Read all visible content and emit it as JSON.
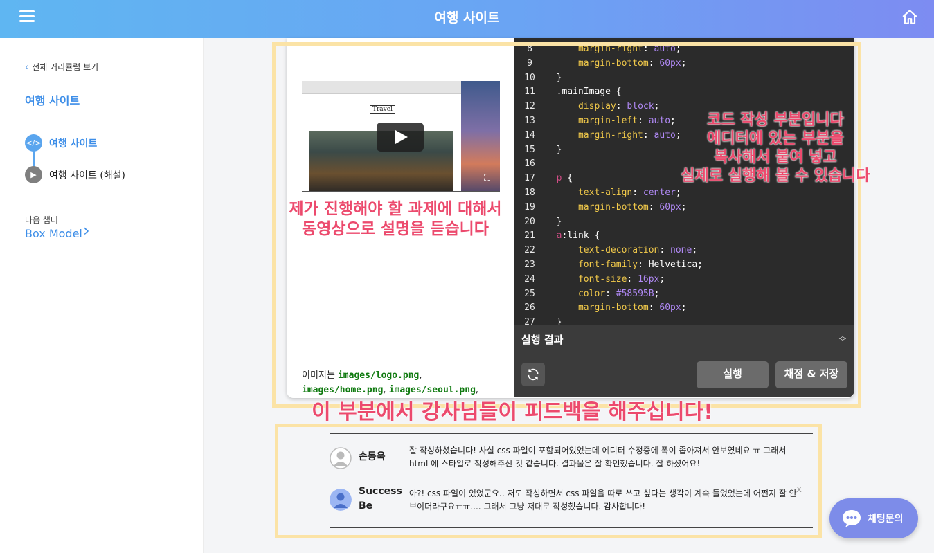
{
  "header": {
    "title": "여행 사이트",
    "menu_icon": "hamburger-icon",
    "home_icon": "home-icon"
  },
  "sidebar": {
    "back_label": "전체 커리큘럼 보기",
    "course_title": "여행 사이트",
    "lessons": [
      {
        "label": "여행 사이트",
        "icon": "code-icon",
        "active": true
      },
      {
        "label": "여행 사이트 (해설)",
        "icon": "play-icon",
        "active": false
      }
    ],
    "next_chapter": {
      "caption": "다음 챕터",
      "title": "Box Model"
    }
  },
  "video": {
    "logo_text": "Travel"
  },
  "description": {
    "prefix": "이미지는 ",
    "files": [
      "images/logo.png",
      "images/home.png",
      "images/seoul.png"
    ],
    "sep": ","
  },
  "editor": {
    "lines": [
      {
        "n": "8",
        "indent": "    ",
        "prop": "margin-right",
        "val": "auto"
      },
      {
        "n": "9",
        "indent": "    ",
        "prop": "margin-bottom",
        "val": "60px"
      },
      {
        "n": "10",
        "brace": "}"
      },
      {
        "n": "11",
        "selector": ".mainImage",
        "open": " {"
      },
      {
        "n": "12",
        "indent": "    ",
        "prop": "display",
        "val": "block"
      },
      {
        "n": "13",
        "indent": "    ",
        "prop": "margin-left",
        "val": "auto"
      },
      {
        "n": "14",
        "indent": "    ",
        "prop": "margin-right",
        "val": "auto"
      },
      {
        "n": "15",
        "brace": "}"
      },
      {
        "n": "16"
      },
      {
        "n": "17",
        "tag": "p",
        "open": " {"
      },
      {
        "n": "18",
        "indent": "    ",
        "prop": "text-align",
        "val": "center"
      },
      {
        "n": "19",
        "indent": "    ",
        "prop": "margin-bottom",
        "val": "60px"
      },
      {
        "n": "20",
        "brace": "}"
      },
      {
        "n": "21",
        "tag": "a",
        "pseudo": ":link",
        "open": " {"
      },
      {
        "n": "22",
        "indent": "    ",
        "prop": "text-decoration",
        "val": "none"
      },
      {
        "n": "23",
        "indent": "    ",
        "prop": "font-family",
        "plain": "Helvetica"
      },
      {
        "n": "24",
        "indent": "    ",
        "prop": "font-size",
        "val": "16px"
      },
      {
        "n": "25",
        "indent": "    ",
        "prop": "color",
        "val": "#58595B"
      },
      {
        "n": "26",
        "indent": "    ",
        "prop": "margin-bottom",
        "val": "60px"
      },
      {
        "n": "27",
        "brace": "}"
      }
    ]
  },
  "result": {
    "title": "실행 결과",
    "run_label": "실행",
    "submit_label": "채점 & 저장"
  },
  "annotations": {
    "video_note": [
      "제가 진행해야 할 과제에 대해서",
      "동영상으로 설명을 듣습니다"
    ],
    "code_note": [
      "코드 작성 부분입니다",
      "에디터에 있는 부분을",
      "복사해서 붙여 넣고",
      "실제로 실행해 볼 수 있습니다"
    ],
    "feedback_note": "이 부분에서 강사님들이 피드백을 해주십니다!"
  },
  "comments": [
    {
      "name": "손동욱",
      "text": "잘 작성하셨습니다! 사실 css 파일이 포함되어있었는데 에디터 수정중에 폭이 좁아져서 안보였네요 ㅠ 그래서 html 에 스타일로 작성해주신 것 같습니다. 결과물은 잘 확인했습니다. 잘 하셨어요!",
      "avatar": "default-avatar-icon"
    },
    {
      "name": "Success Be",
      "text": "아?! css 파일이 있었군요.. 저도 작성하면서 css 파일을 따로 쓰고 싶다는 생각이 계속 들었었는데 어쩐지 잘 안보이더라구요ㅠㅠ.... 그래서 그냥 저대로 작성했습니다. 감사합니다!",
      "avatar": "user-avatar-icon",
      "close": "x"
    }
  ],
  "chat": {
    "label": "채팅문의"
  },
  "colors": {
    "accent": "#3d8ee8",
    "annotation": "#ec4a6d",
    "highlight_box": "#fbe3a6",
    "editor_bg": "#2b2b2b"
  }
}
